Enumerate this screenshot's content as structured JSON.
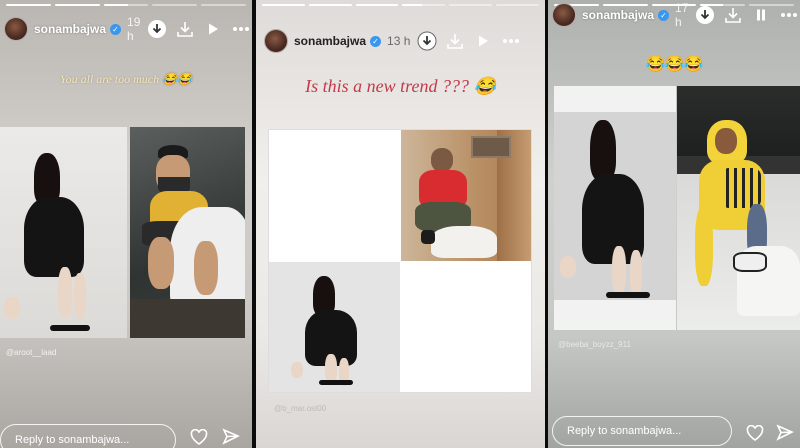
{
  "stories": [
    {
      "username": "sonambajwa",
      "time": "19 h",
      "caption": "You all are too much 😂😂",
      "tag": "@aroot__laad",
      "reply_placeholder": "Reply to sonambajwa...",
      "progress": [
        1,
        1,
        0.55,
        0,
        0
      ],
      "control_icon": "play-icon"
    },
    {
      "username": "sonambajwa",
      "time": "13 h",
      "caption": "Is this a new trend ??? 😂",
      "tag": "@b_mar.ost00",
      "progress": [
        1,
        1,
        1,
        0.45,
        0,
        0
      ],
      "control_icon": "play-icon"
    },
    {
      "username": "sonambajwa",
      "time": "17 h",
      "caption": "😂😂😂",
      "tag": "@beeba_boyzz_911",
      "reply_placeholder": "Reply to sonambajwa...",
      "progress": [
        1,
        1,
        1,
        0.5,
        0
      ],
      "control_icon": "pause-icon"
    }
  ],
  "colors": {
    "caption_gold": "#f7e6b4",
    "caption_red": "#c43a4a",
    "verified_blue": "#3897f0"
  }
}
